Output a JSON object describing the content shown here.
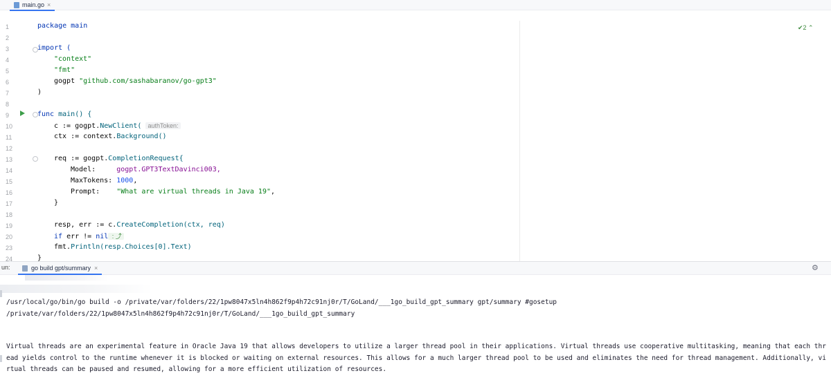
{
  "editor": {
    "tab_label": "main.go",
    "tab_close": "×",
    "inspection": "✔2 ⌃",
    "line_numbers": [
      "1",
      "2",
      "3",
      "4",
      "5",
      "6",
      "7",
      "8",
      "9",
      "10",
      "11",
      "12",
      "13",
      "14",
      "15",
      "16",
      "17",
      "18",
      "19",
      "20",
      "23",
      "24"
    ],
    "lines": {
      "l1": "package main",
      "l3": "import (",
      "l4": "\"context\"",
      "l5": "\"fmt\"",
      "l6a": "gogpt ",
      "l6b": "\"github.com/sashabaranov/go-gpt3\"",
      "l7": ")",
      "l9a": "func ",
      "l9b": "main() {",
      "l10a": "c := gogpt.",
      "l10b": "NewClient(",
      "l10hint": "authToken:",
      "l11a": "ctx := context.",
      "l11b": "Background()",
      "l13a": "req := gogpt.",
      "l13b": "CompletionRequest{",
      "l14a": "Model:     ",
      "l14b": "gogpt.GPT3TextDavinci003,",
      "l15a": "MaxTokens: ",
      "l15b": "1000",
      "l15c": ",",
      "l16a": "Prompt:    ",
      "l16b": "\"What are virtual threads in Java 19\"",
      "l16c": ",",
      "l17": "}",
      "l19a": "resp, err := c.",
      "l19b": "CreateCompletion(ctx, req)",
      "l20a": "if ",
      "l20b": "err != ",
      "l20c": "nil",
      "l20d": " : ⤴",
      "l23a": "fmt.",
      "l23b": "Println(resp.Choices[0].Text)",
      "l24": "}"
    }
  },
  "run": {
    "label": "un:",
    "tab_label": "go build gpt/summary",
    "tab_close": "×",
    "settings_icon": "⚙",
    "console": {
      "cmd_line": "/usr/local/go/bin/go build -o /private/var/folders/22/1pw8047x5ln4h862f9p4h72c91nj0r/T/GoLand/___1go_build_gpt_summary gpt/summary #gosetup",
      "exec_line": "/private/var/folders/22/1pw8047x5ln4h862f9p4h72c91nj0r/T/GoLand/___1go_build_gpt_summary",
      "output": "Virtual threads are an experimental feature in Oracle Java 19 that allows developers to utilize a larger thread pool in their applications. Virtual threads use cooperative multitasking, meaning that each thread yields control to the runtime whenever it is blocked or waiting on external resources. This allows for a much larger thread pool to be used and eliminates the need for thread management. Additionally, virtual threads can be paused and resumed, allowing for a more efficient utilization of resources."
    }
  },
  "colors": {
    "keyword": "#0033b3",
    "string": "#067d17",
    "function": "#00627a",
    "number": "#1750eb",
    "accent": "#3574f0"
  }
}
